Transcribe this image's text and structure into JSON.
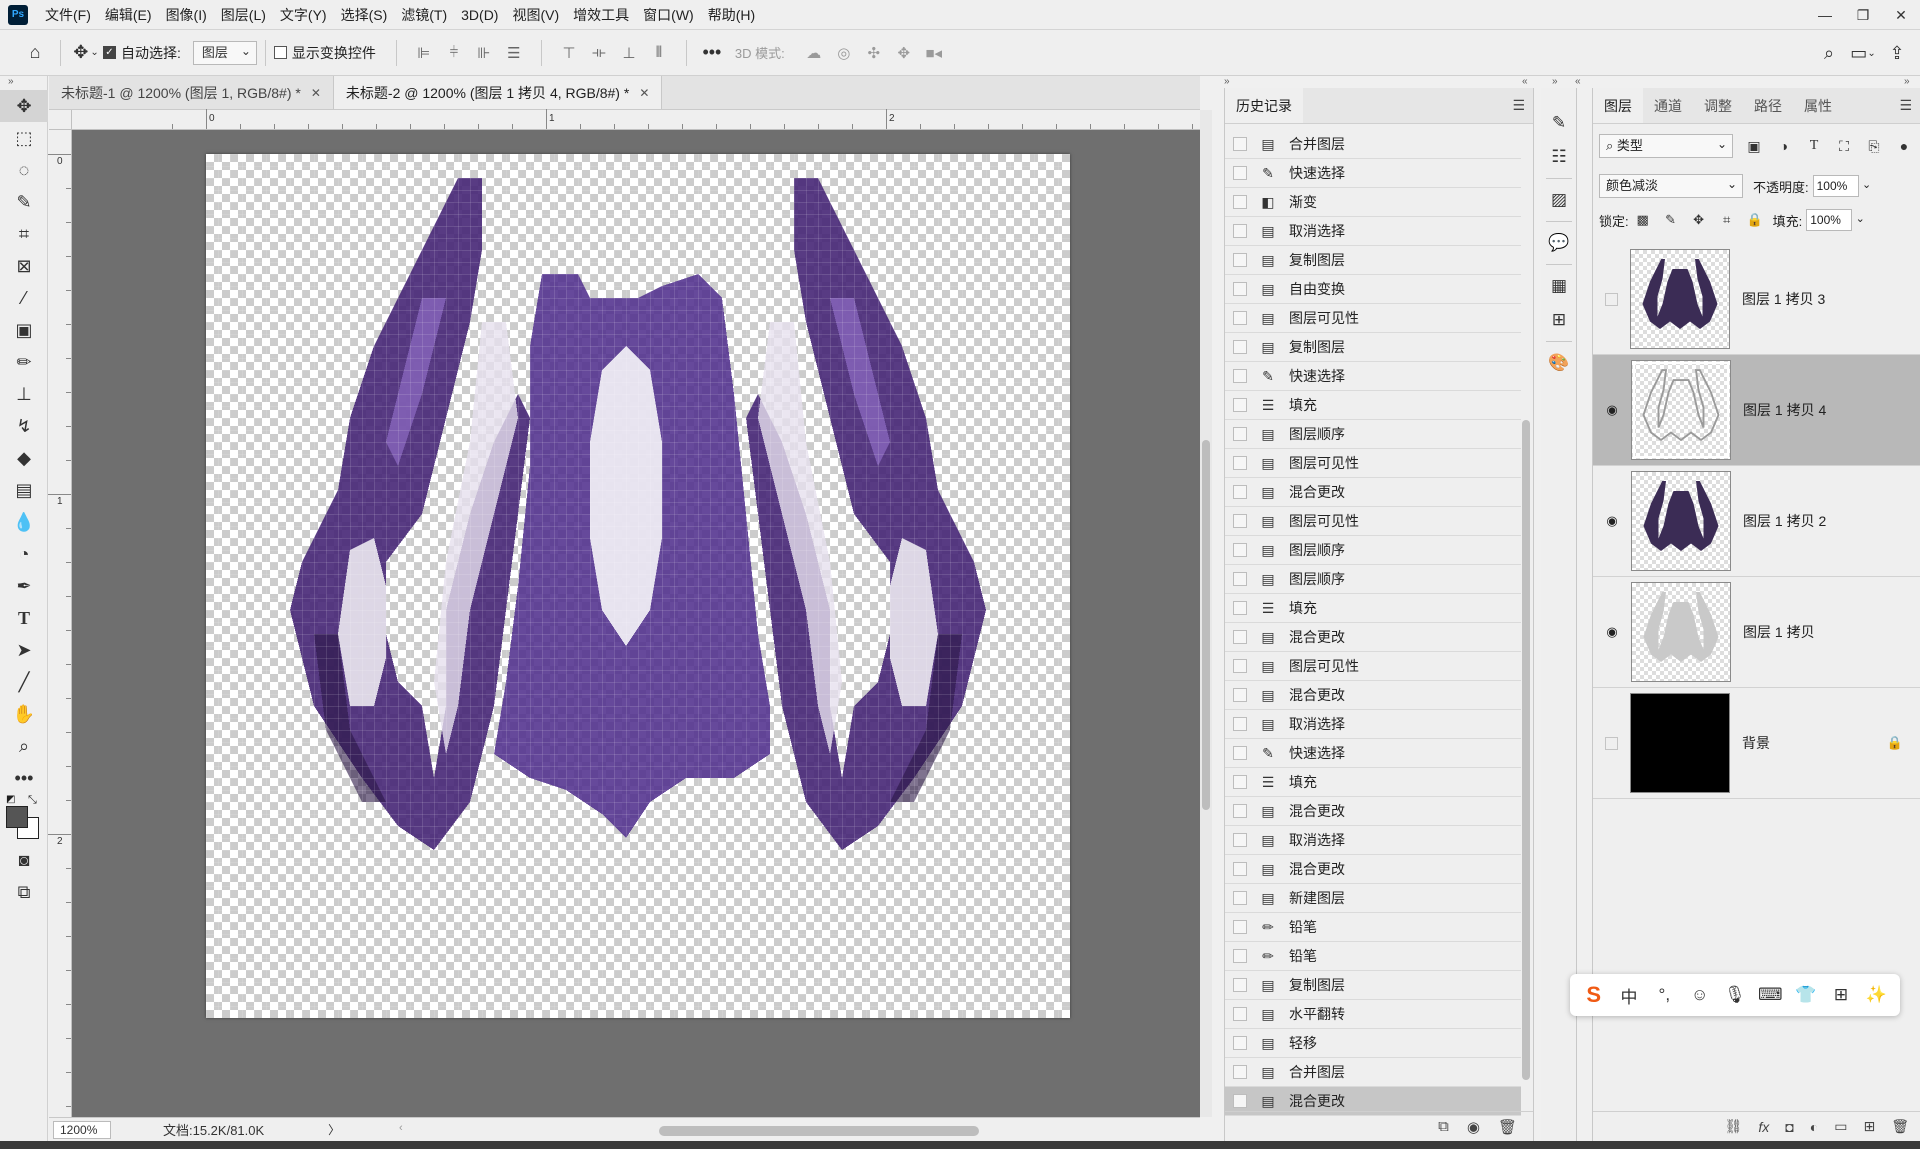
{
  "app": {
    "logo": "Ps",
    "menu": [
      "文件(F)",
      "编辑(E)",
      "图像(I)",
      "图层(L)",
      "文字(Y)",
      "选择(S)",
      "滤镜(T)",
      "3D(D)",
      "视图(V)",
      "增效工具",
      "窗口(W)",
      "帮助(H)"
    ]
  },
  "options": {
    "auto_select_label": "自动选择:",
    "auto_select_value": "图层",
    "show_transform_label": "显示变换控件",
    "mode_3d_label": "3D 模式:"
  },
  "tabs": [
    {
      "label": "未标题-1 @ 1200% (图层 1, RGB/8#) *"
    },
    {
      "label": "未标题-2 @ 1200% (图层 1 拷贝 4, RGB/8#) *"
    }
  ],
  "rulers": {
    "h": [
      "0",
      "1",
      "2"
    ],
    "v": [
      "0",
      "1",
      "2"
    ]
  },
  "status": {
    "zoom": "1200%",
    "doc_info": "文档:15.2K/81.0K",
    "arrow": "〉"
  },
  "history": {
    "tab_label": "历史记录",
    "items": [
      {
        "label": "合并图层",
        "icon": "doc-icon"
      },
      {
        "label": "快速选择",
        "icon": "quick-select-icon"
      },
      {
        "label": "渐变",
        "icon": "gradient-icon"
      },
      {
        "label": "取消选择",
        "icon": "doc-icon"
      },
      {
        "label": "复制图层",
        "icon": "doc-icon"
      },
      {
        "label": "自由变换",
        "icon": "doc-icon"
      },
      {
        "label": "图层可见性",
        "icon": "doc-icon"
      },
      {
        "label": "复制图层",
        "icon": "doc-icon"
      },
      {
        "label": "快速选择",
        "icon": "quick-select-icon"
      },
      {
        "label": "填充",
        "icon": "fill-icon"
      },
      {
        "label": "图层顺序",
        "icon": "doc-icon"
      },
      {
        "label": "图层可见性",
        "icon": "doc-icon"
      },
      {
        "label": "混合更改",
        "icon": "doc-icon"
      },
      {
        "label": "图层可见性",
        "icon": "doc-icon"
      },
      {
        "label": "图层顺序",
        "icon": "doc-icon"
      },
      {
        "label": "图层顺序",
        "icon": "doc-icon"
      },
      {
        "label": "填充",
        "icon": "fill-icon"
      },
      {
        "label": "混合更改",
        "icon": "doc-icon"
      },
      {
        "label": "图层可见性",
        "icon": "doc-icon"
      },
      {
        "label": "混合更改",
        "icon": "doc-icon"
      },
      {
        "label": "取消选择",
        "icon": "doc-icon"
      },
      {
        "label": "快速选择",
        "icon": "quick-select-icon"
      },
      {
        "label": "填充",
        "icon": "fill-icon"
      },
      {
        "label": "混合更改",
        "icon": "doc-icon"
      },
      {
        "label": "取消选择",
        "icon": "doc-icon"
      },
      {
        "label": "混合更改",
        "icon": "doc-icon"
      },
      {
        "label": "新建图层",
        "icon": "doc-icon"
      },
      {
        "label": "铅笔",
        "icon": "pencil-icon"
      },
      {
        "label": "铅笔",
        "icon": "pencil-icon"
      },
      {
        "label": "复制图层",
        "icon": "doc-icon"
      },
      {
        "label": "水平翻转",
        "icon": "doc-icon"
      },
      {
        "label": "轻移",
        "icon": "doc-icon"
      },
      {
        "label": "合并图层",
        "icon": "doc-icon"
      },
      {
        "label": "混合更改",
        "icon": "doc-icon"
      }
    ],
    "selected_index": 33
  },
  "layers_panel": {
    "tabs": [
      "图层",
      "通道",
      "调整",
      "路径",
      "属性"
    ],
    "filter_value": "类型",
    "blend_mode": "颜色减淡",
    "opacity_label": "不透明度:",
    "opacity_value": "100%",
    "lock_label": "锁定:",
    "fill_label": "填充:",
    "fill_value": "100%",
    "layers": [
      {
        "name": "图层 1 拷贝 3",
        "visible": false,
        "thumb": "dark"
      },
      {
        "name": "图层 1 拷贝 4",
        "visible": true,
        "thumb": "outline",
        "selected": true
      },
      {
        "name": "图层 1 拷贝 2",
        "visible": true,
        "thumb": "dark"
      },
      {
        "name": "图层 1 拷贝",
        "visible": true,
        "thumb": "light"
      },
      {
        "name": "背景",
        "visible": false,
        "thumb": "black",
        "locked": true
      }
    ]
  },
  "ime": {
    "logo": "S",
    "lang": "中",
    "punct": "°,"
  },
  "colors": {
    "accent": "#31a8ff",
    "purple_dark": "#3b1f5c",
    "purple_mid": "#5b3a8c",
    "purple_light": "#7d5aa8"
  }
}
